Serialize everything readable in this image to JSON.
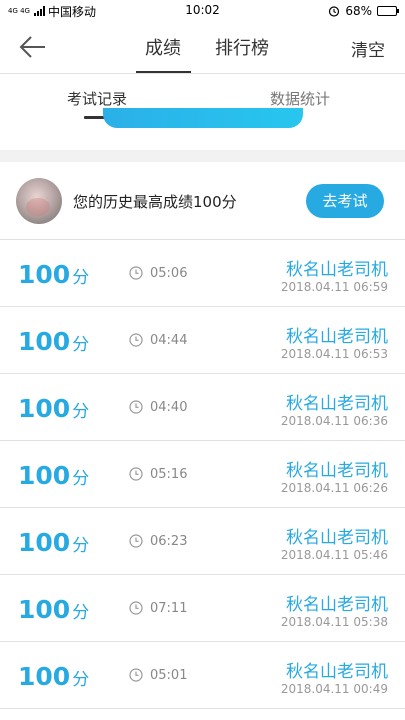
{
  "status_bar": {
    "network": "4G 4G",
    "carrier": "中国移动",
    "time": "10:02",
    "battery": "68%",
    "battery_level": 0.68
  },
  "header": {
    "tabs": [
      "成绩",
      "排行榜"
    ],
    "active_tab": "成绩",
    "clear_label": "清空"
  },
  "subtabs": {
    "items": [
      "考试记录",
      "数据统计"
    ],
    "active": "考试记录"
  },
  "best": {
    "text": "您的历史最高成绩100分",
    "button": "去考试"
  },
  "records": [
    {
      "score": "100",
      "unit": "分",
      "duration": "05:06",
      "name": "秋名山老司机",
      "date": "2018.04.11",
      "time": "06:59"
    },
    {
      "score": "100",
      "unit": "分",
      "duration": "04:44",
      "name": "秋名山老司机",
      "date": "2018.04.11",
      "time": "06:53"
    },
    {
      "score": "100",
      "unit": "分",
      "duration": "04:40",
      "name": "秋名山老司机",
      "date": "2018.04.11",
      "time": "06:36"
    },
    {
      "score": "100",
      "unit": "分",
      "duration": "05:16",
      "name": "秋名山老司机",
      "date": "2018.04.11",
      "time": "06:26"
    },
    {
      "score": "100",
      "unit": "分",
      "duration": "06:23",
      "name": "秋名山老司机",
      "date": "2018.04.11",
      "time": "05:46"
    },
    {
      "score": "100",
      "unit": "分",
      "duration": "07:11",
      "name": "秋名山老司机",
      "date": "2018.04.11",
      "time": "05:38"
    },
    {
      "score": "100",
      "unit": "分",
      "duration": "05:01",
      "name": "秋名山老司机",
      "date": "2018.04.11",
      "time": "00:49"
    }
  ],
  "colors": {
    "accent": "#27a9e1",
    "divider": "#e2e2e2",
    "text_gray": "#999999"
  },
  "icons": {
    "back": "arrow-left-icon",
    "clock": "clock-icon",
    "alarm": "alarm-icon",
    "battery": "battery-icon"
  }
}
